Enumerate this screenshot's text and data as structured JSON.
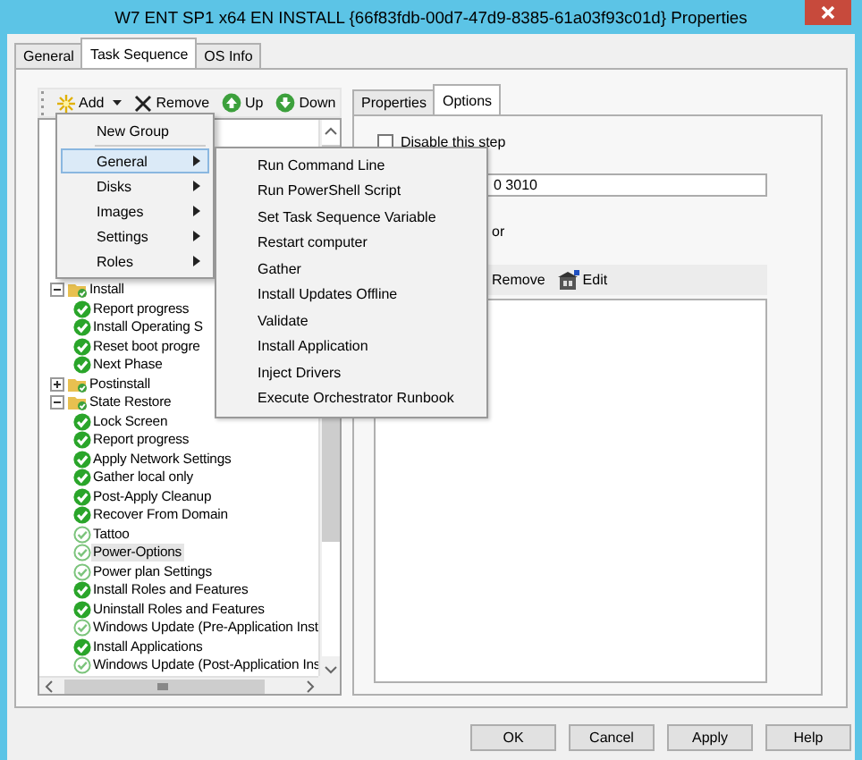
{
  "window": {
    "title": "W7 ENT SP1 x64 EN INSTALL {66f83fdb-00d7-47d9-8385-61a03f93c01d} Properties"
  },
  "tabs": [
    {
      "label": "General",
      "selected": false
    },
    {
      "label": "Task Sequence",
      "selected": true
    },
    {
      "label": "OS Info",
      "selected": false
    }
  ],
  "sequence_toolbar": {
    "buttons": [
      {
        "label": "Add",
        "kind": "add"
      },
      {
        "label": "Remove",
        "kind": "remove"
      },
      {
        "label": "Up",
        "kind": "up"
      },
      {
        "label": "Down",
        "kind": "down"
      }
    ]
  },
  "tree": {
    "items": [
      {
        "label": "Install",
        "kind": "group",
        "expanded": true,
        "children": [
          {
            "label": "Report progress",
            "kind": "step",
            "dimmed": false,
            "selected": false
          },
          {
            "label": "Install Operating S",
            "kind": "step",
            "dimmed": false,
            "selected": false
          },
          {
            "label": "Reset boot progre",
            "kind": "step",
            "dimmed": false,
            "selected": false
          },
          {
            "label": "Next Phase",
            "kind": "step",
            "dimmed": false,
            "selected": false
          }
        ]
      },
      {
        "label": "Postinstall",
        "kind": "group",
        "expanded": false
      },
      {
        "label": "State Restore",
        "kind": "group",
        "expanded": true,
        "children": [
          {
            "label": "Lock Screen",
            "kind": "step",
            "dimmed": false,
            "selected": false
          },
          {
            "label": "Report progress",
            "kind": "step",
            "dimmed": false,
            "selected": false
          },
          {
            "label": "Apply Network Settings",
            "kind": "step",
            "dimmed": false,
            "selected": false
          },
          {
            "label": "Gather local only",
            "kind": "step",
            "dimmed": false,
            "selected": false
          },
          {
            "label": "Post-Apply Cleanup",
            "kind": "step",
            "dimmed": false,
            "selected": false
          },
          {
            "label": "Recover From Domain",
            "kind": "step",
            "dimmed": false,
            "selected": false
          },
          {
            "label": "Tattoo",
            "kind": "step",
            "dimmed": true,
            "selected": false
          },
          {
            "label": "Power-Options",
            "kind": "step",
            "dimmed": true,
            "selected": true
          },
          {
            "label": "Power plan Settings",
            "kind": "step",
            "dimmed": true,
            "selected": false
          },
          {
            "label": "Install Roles and Features",
            "kind": "step",
            "dimmed": false,
            "selected": false
          },
          {
            "label": "Uninstall Roles and Features",
            "kind": "step",
            "dimmed": false,
            "selected": false
          },
          {
            "label": "Windows Update (Pre-Application Inst",
            "kind": "step",
            "dimmed": true,
            "selected": false
          },
          {
            "label": "Install Applications",
            "kind": "step",
            "dimmed": false,
            "selected": false
          },
          {
            "label": "Windows Update (Post-Application Ins",
            "kind": "step",
            "dimmed": true,
            "selected": false
          }
        ]
      }
    ]
  },
  "add_menu": {
    "items": [
      {
        "label": "New Group",
        "has_submenu": false,
        "selected": false
      },
      {
        "label": "General",
        "has_submenu": true,
        "selected": true
      },
      {
        "label": "Disks",
        "has_submenu": true,
        "selected": false
      },
      {
        "label": "Images",
        "has_submenu": true,
        "selected": false
      },
      {
        "label": "Settings",
        "has_submenu": true,
        "selected": false
      },
      {
        "label": "Roles",
        "has_submenu": true,
        "selected": false
      }
    ]
  },
  "submenu": {
    "items": [
      "Run Command Line",
      "Run PowerShell Script",
      "Set Task Sequence Variable",
      "Restart computer",
      "Gather",
      "Install Updates Offline",
      "Validate",
      "Install Application",
      "Inject Drivers",
      "Execute Orchestrator Runbook"
    ]
  },
  "step_tabs": [
    {
      "label": "Properties",
      "selected": false
    },
    {
      "label": "Options",
      "selected": true
    }
  ],
  "options": {
    "disable_step": {
      "label": "Disable this step",
      "checked": false
    },
    "field": {
      "value": "0 3010"
    },
    "label_text": "or",
    "conditions_toolbar": {
      "buttons": [
        {
          "label": "Remove",
          "kind": "remove"
        },
        {
          "label": "Edit",
          "kind": "edit"
        }
      ]
    }
  },
  "buttons": [
    {
      "label": "OK"
    },
    {
      "label": "Cancel"
    },
    {
      "label": "Apply"
    },
    {
      "label": "Help"
    }
  ]
}
